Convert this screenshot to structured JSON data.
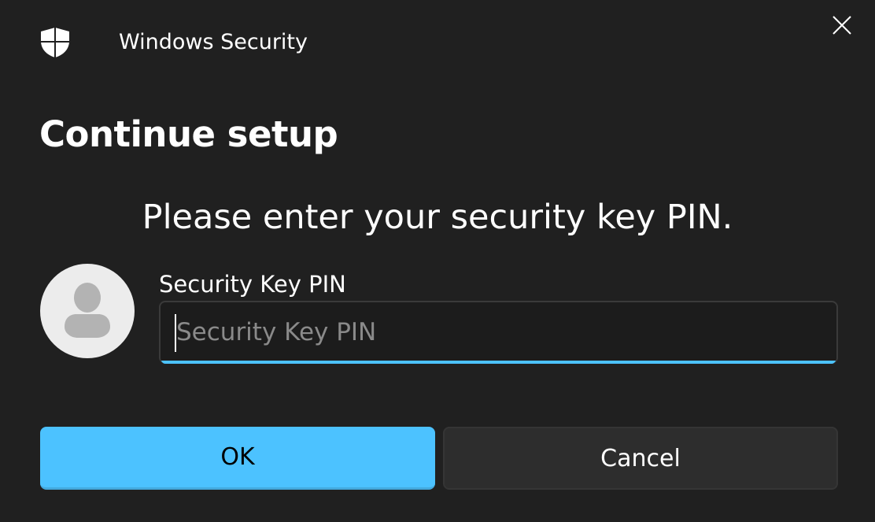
{
  "window": {
    "title": "Windows Security",
    "app_icon": "shield-icon",
    "close_icon": "close-icon"
  },
  "dialog": {
    "heading": "Continue setup",
    "prompt": "Please enter your security key PIN.",
    "avatar_icon": "user-avatar-icon"
  },
  "pin_field": {
    "label": "Security Key PIN",
    "placeholder": "Security Key PIN",
    "value": ""
  },
  "buttons": {
    "ok_label": "OK",
    "cancel_label": "Cancel"
  },
  "colors": {
    "background": "#202020",
    "accent": "#4cc2ff",
    "button_secondary": "#2d2d2d",
    "avatar_background": "#ececec",
    "avatar_figure": "#b3b3b3"
  }
}
